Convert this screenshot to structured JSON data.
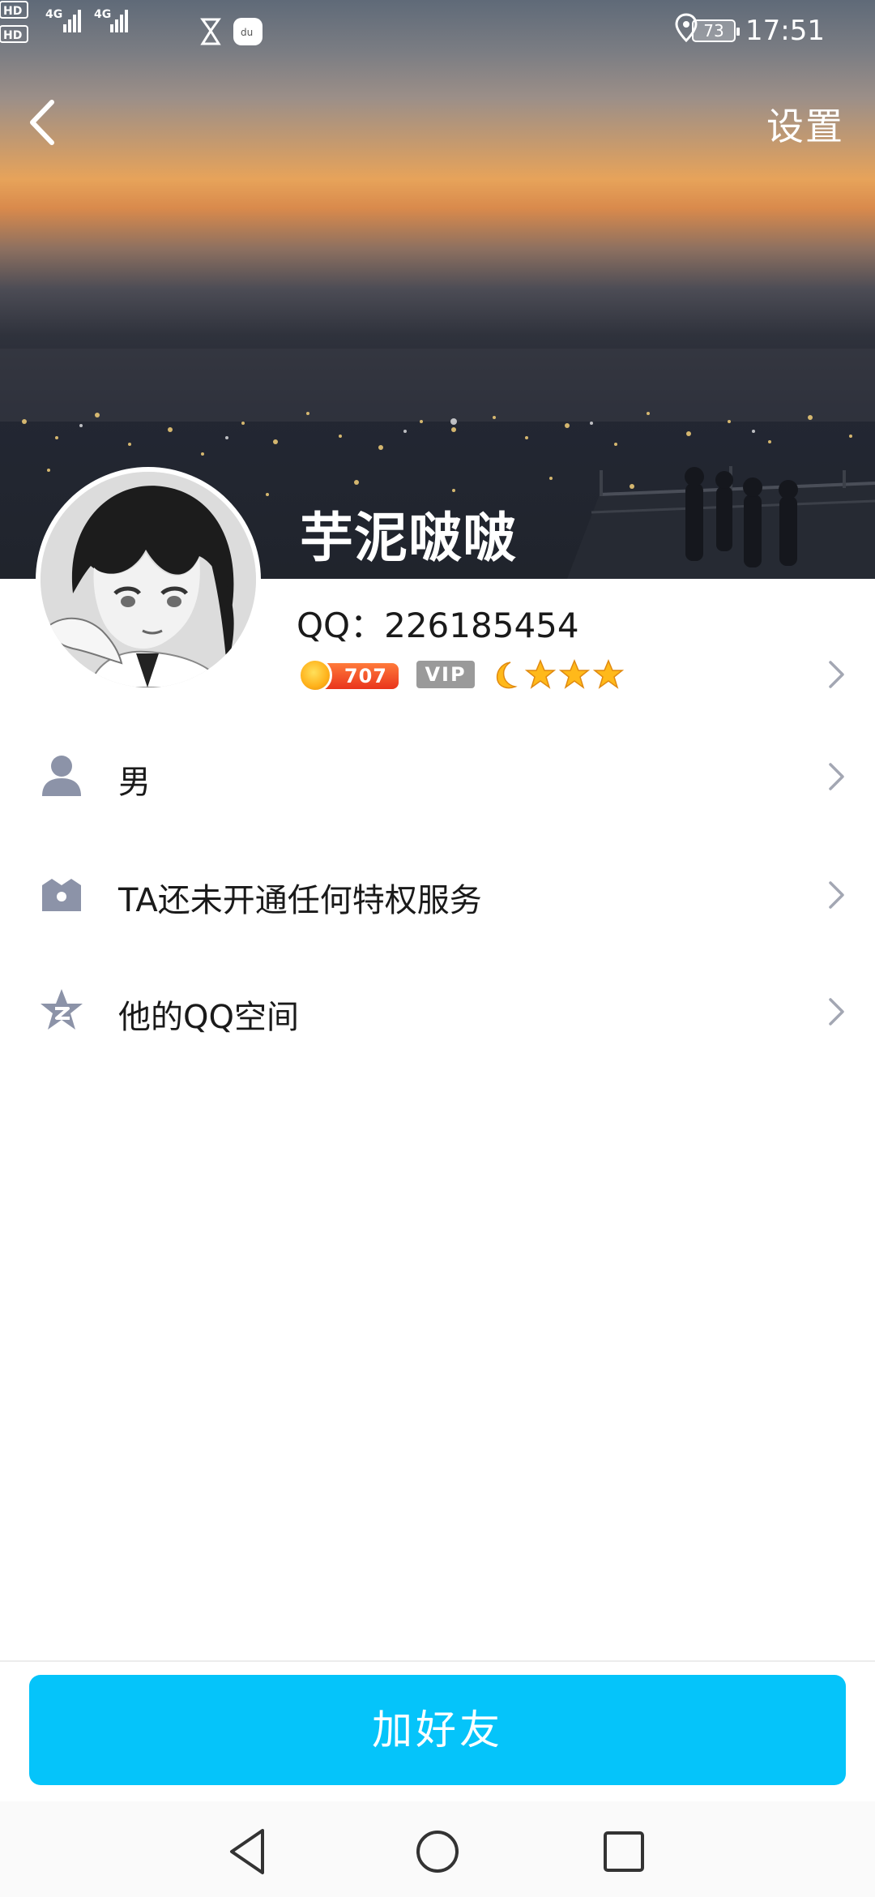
{
  "status_bar": {
    "time": "17:51",
    "battery": "73",
    "network": "4G",
    "icons": [
      "hd-icon",
      "signal-icon",
      "hourglass-icon",
      "baidu-maps-icon",
      "location-icon",
      "battery-icon"
    ]
  },
  "header": {
    "back_icon": "back-arrow-icon",
    "settings_label": "设置"
  },
  "profile": {
    "nickname": "芋泥啵啵",
    "qq_label": "QQ：226185454",
    "level_badge": "707",
    "vip_badge": "VIP",
    "level_icons": [
      "moon-icon",
      "star-icon",
      "star-icon",
      "star-icon"
    ]
  },
  "info_list": [
    {
      "icon": "person-icon",
      "label": "男"
    },
    {
      "icon": "crown-icon",
      "label": "TA还未开通任何特权服务"
    },
    {
      "icon": "qzone-icon",
      "label": "他的QQ空间"
    }
  ],
  "action": {
    "add_friend_label": "加好友"
  },
  "nav_bar": {
    "buttons": [
      "back-nav-icon",
      "home-nav-icon",
      "recents-nav-icon"
    ]
  },
  "colors": {
    "accent": "#05c4fa",
    "level_badge": "#e9341c",
    "vip_badge": "#9a9a9a",
    "icon_gray": "#8c93a8",
    "star": "#ffb91a"
  }
}
